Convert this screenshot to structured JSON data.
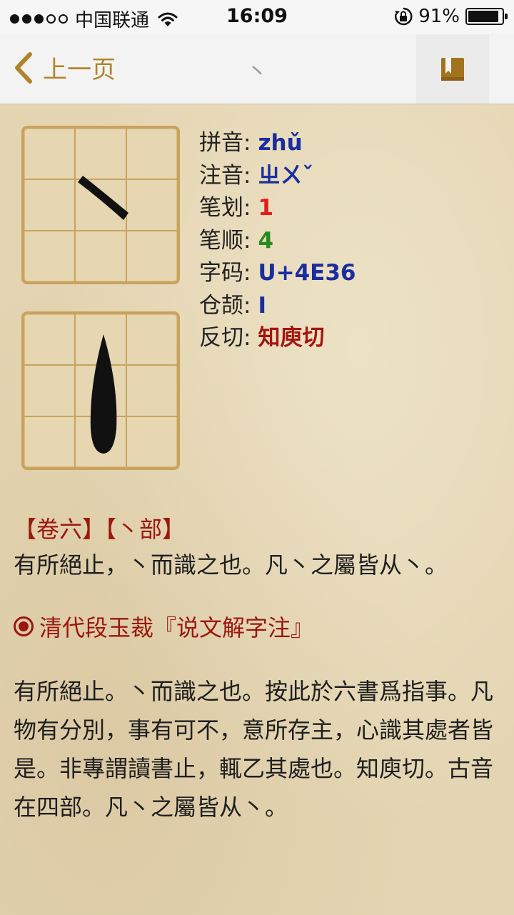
{
  "status_bar": {
    "carrier": "中国联通",
    "time": "16:09",
    "battery_percent": "91%",
    "battery_level": 0.91,
    "signal_bars_filled": 3,
    "signal_bars_total": 5
  },
  "nav": {
    "back_label": "上一页",
    "title": "丶"
  },
  "character_info": [
    {
      "label": "拼音:",
      "value": "zhǔ",
      "color": "#1b2d9e"
    },
    {
      "label": "注音:",
      "value": "ㄓㄨˇ",
      "color": "#1b2d9e"
    },
    {
      "label": "笔划:",
      "value": "1",
      "color": "#e11d1d"
    },
    {
      "label": "笔顺:",
      "value": "4",
      "color": "#2a8a22"
    },
    {
      "label": "字码:",
      "value": "U+4E36",
      "color": "#1b2d9e"
    },
    {
      "label": "仓颉:",
      "value": "I",
      "color": "#1b2d9e"
    },
    {
      "label": "反切:",
      "value": "知庾切",
      "color": "#a3160f"
    }
  ],
  "shuowen": {
    "heading": "【卷六】【丶部】",
    "text": "有所絕止，丶而識之也。凡丶之屬皆从丶。"
  },
  "annotation": {
    "heading": "清代段玉裁『说文解字注』",
    "text": "有所絕止。丶而識之也。按此於六書爲指事。凡物有分別，事有可不，意所存主，心識其處者皆是。非專謂讀書止，輒乙其處也。知庾切。古音在四部。凡丶之屬皆从丶。"
  },
  "colors": {
    "accent": "#b1842b",
    "heading_red": "#9b170f",
    "grid_border": "#c9a35e"
  },
  "icons": {
    "back": "chevron-left-icon",
    "bookmark": "book-icon",
    "wifi": "wifi-icon",
    "orientation_lock": "rotation-lock-icon",
    "bullet": "target-bullet-icon"
  }
}
